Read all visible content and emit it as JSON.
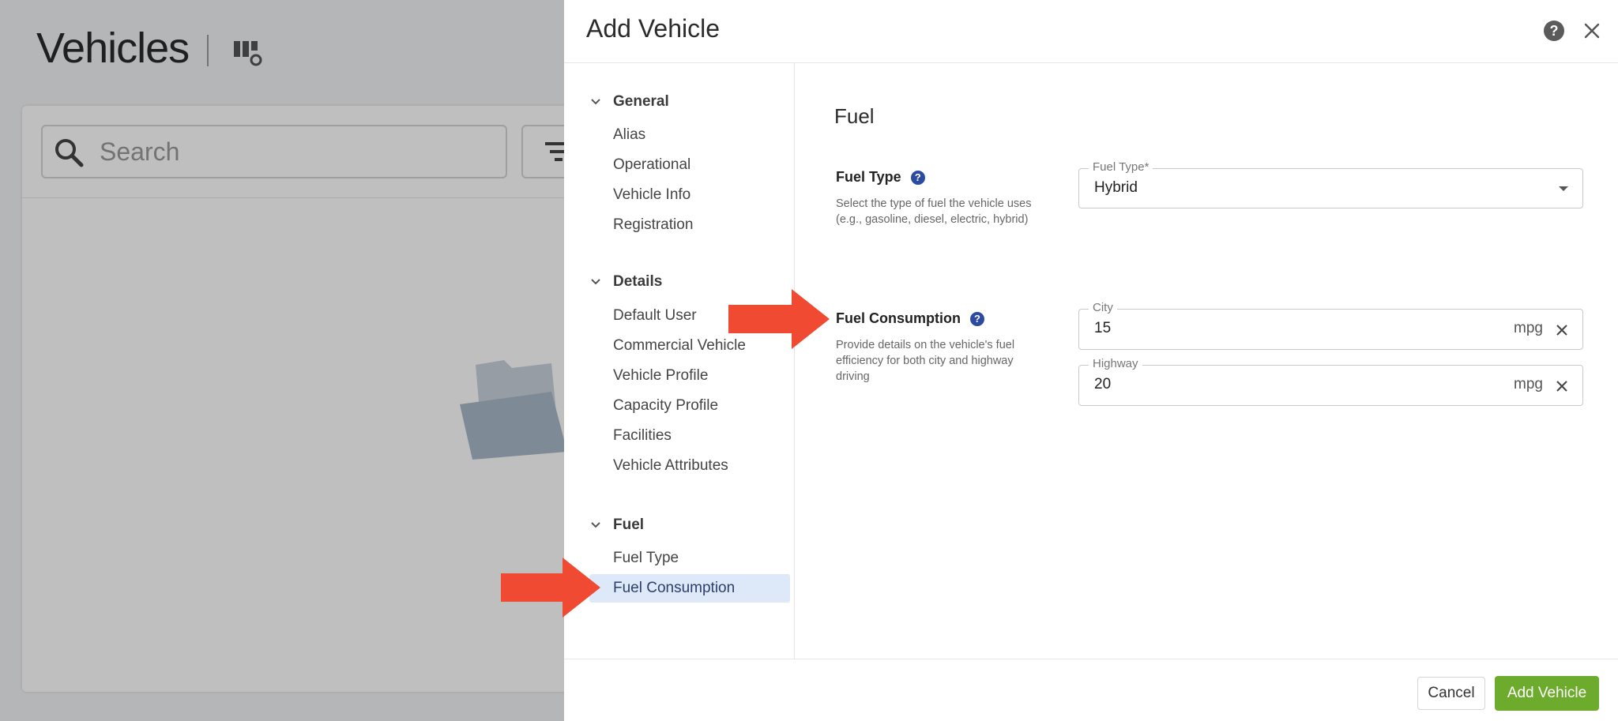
{
  "background": {
    "page_title": "Vehicles",
    "search_placeholder": "Search"
  },
  "modal": {
    "title": "Add Vehicle",
    "icons": {
      "help": "help-icon",
      "close": "close-icon"
    },
    "nav": {
      "sections": [
        {
          "label": "General",
          "items": [
            "Alias",
            "Operational",
            "Vehicle Info",
            "Registration"
          ]
        },
        {
          "label": "Details",
          "items": [
            "Default User",
            "Commercial Vehicle",
            "Vehicle Profile",
            "Capacity Profile",
            "Facilities",
            "Vehicle Attributes"
          ]
        },
        {
          "label": "Fuel",
          "items": [
            "Fuel Type",
            "Fuel Consumption"
          ]
        }
      ],
      "active_item": "Fuel Consumption"
    },
    "content": {
      "section_title": "Fuel",
      "fuel_type": {
        "label": "Fuel Type",
        "help_glyph": "?",
        "description": "Select the type of fuel the vehicle uses (e.g., gasoline, diesel, electric, hybrid)",
        "select_legend": "Fuel Type*",
        "select_value": "Hybrid"
      },
      "fuel_consumption": {
        "label": "Fuel Consumption",
        "help_glyph": "?",
        "description": "Provide details on the vehicle's fuel efficiency for both city and highway driving",
        "city": {
          "legend": "City",
          "value": "15",
          "unit": "mpg"
        },
        "highway": {
          "legend": "Highway",
          "value": "20",
          "unit": "mpg"
        }
      }
    },
    "footer": {
      "cancel_label": "Cancel",
      "add_label": "Add Vehicle"
    }
  },
  "colors": {
    "accent_green": "#6cab2c",
    "active_nav_bg": "#dde9f8",
    "help_blue": "#2d4aa3",
    "annotation_red": "#f04a33"
  }
}
